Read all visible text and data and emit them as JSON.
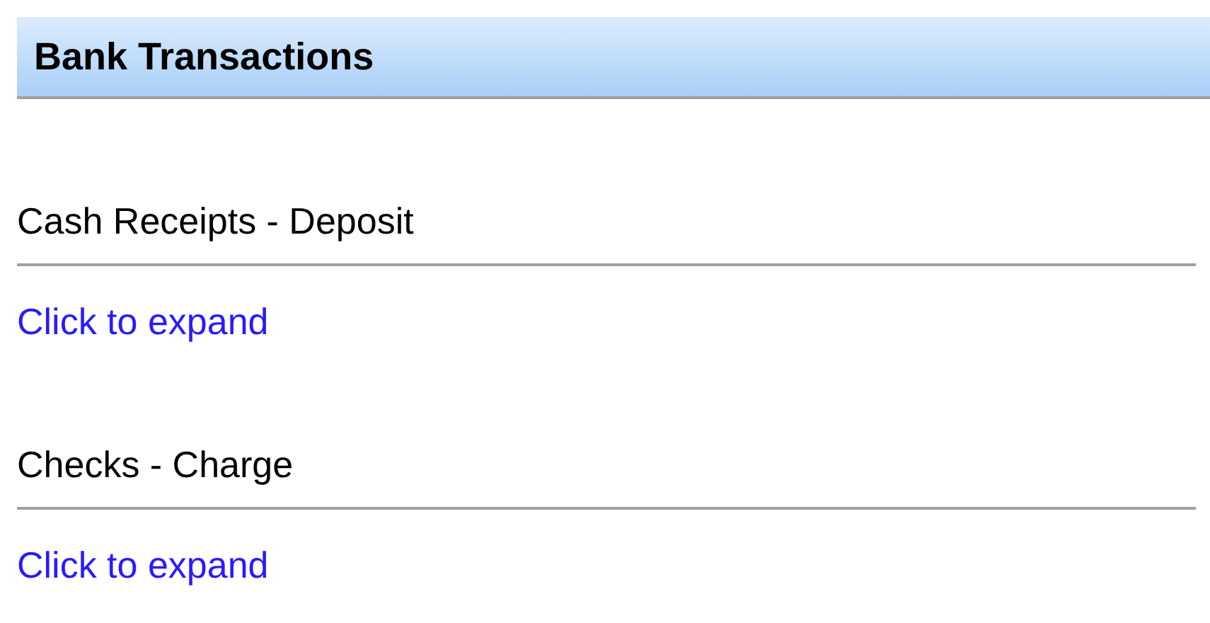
{
  "header": {
    "title": "Bank Transactions"
  },
  "sections": [
    {
      "title": "Cash Receipts - Deposit",
      "link": "Click to expand"
    },
    {
      "title": "Checks - Charge",
      "link": "Click to expand"
    }
  ]
}
